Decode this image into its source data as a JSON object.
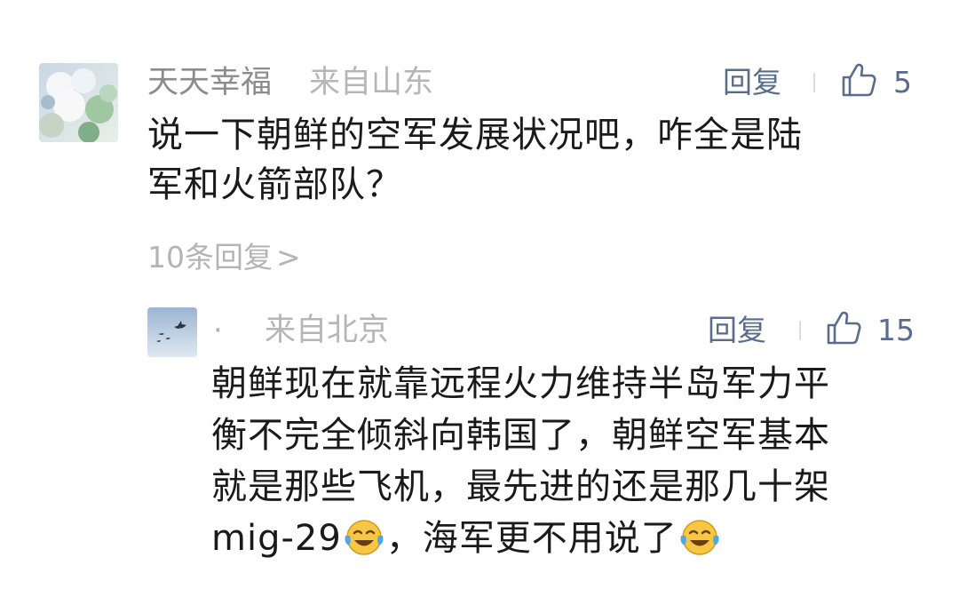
{
  "comment": {
    "username": "天天幸福",
    "location": "来自山东",
    "reply_label": "回复",
    "like_count": "5",
    "text_lines": [
      "说一下朝鲜的空军发展状况吧，咋全是陆",
      "军和火箭部队？"
    ],
    "replies_link": "10条回复",
    "replies_chevron": ">"
  },
  "reply": {
    "username": "·",
    "location": "来自北京",
    "reply_label": "回复",
    "like_count": "15",
    "text_lines": [
      "朝鲜现在就靠远程火力维持半岛军力平",
      "衡不完全倾斜向韩国了，朝鲜空军基本",
      "就是那些飞机，最先进的还是那几十架",
      "mig-29",
      "，海军更不用说了"
    ],
    "emoji": "crying-laughing-emoji"
  },
  "icons": {
    "like": "thumbs-up-icon"
  },
  "colors": {
    "action": "#5a6b8c",
    "meta": "#8c8c8c",
    "meta_light": "#b6b6b6"
  }
}
